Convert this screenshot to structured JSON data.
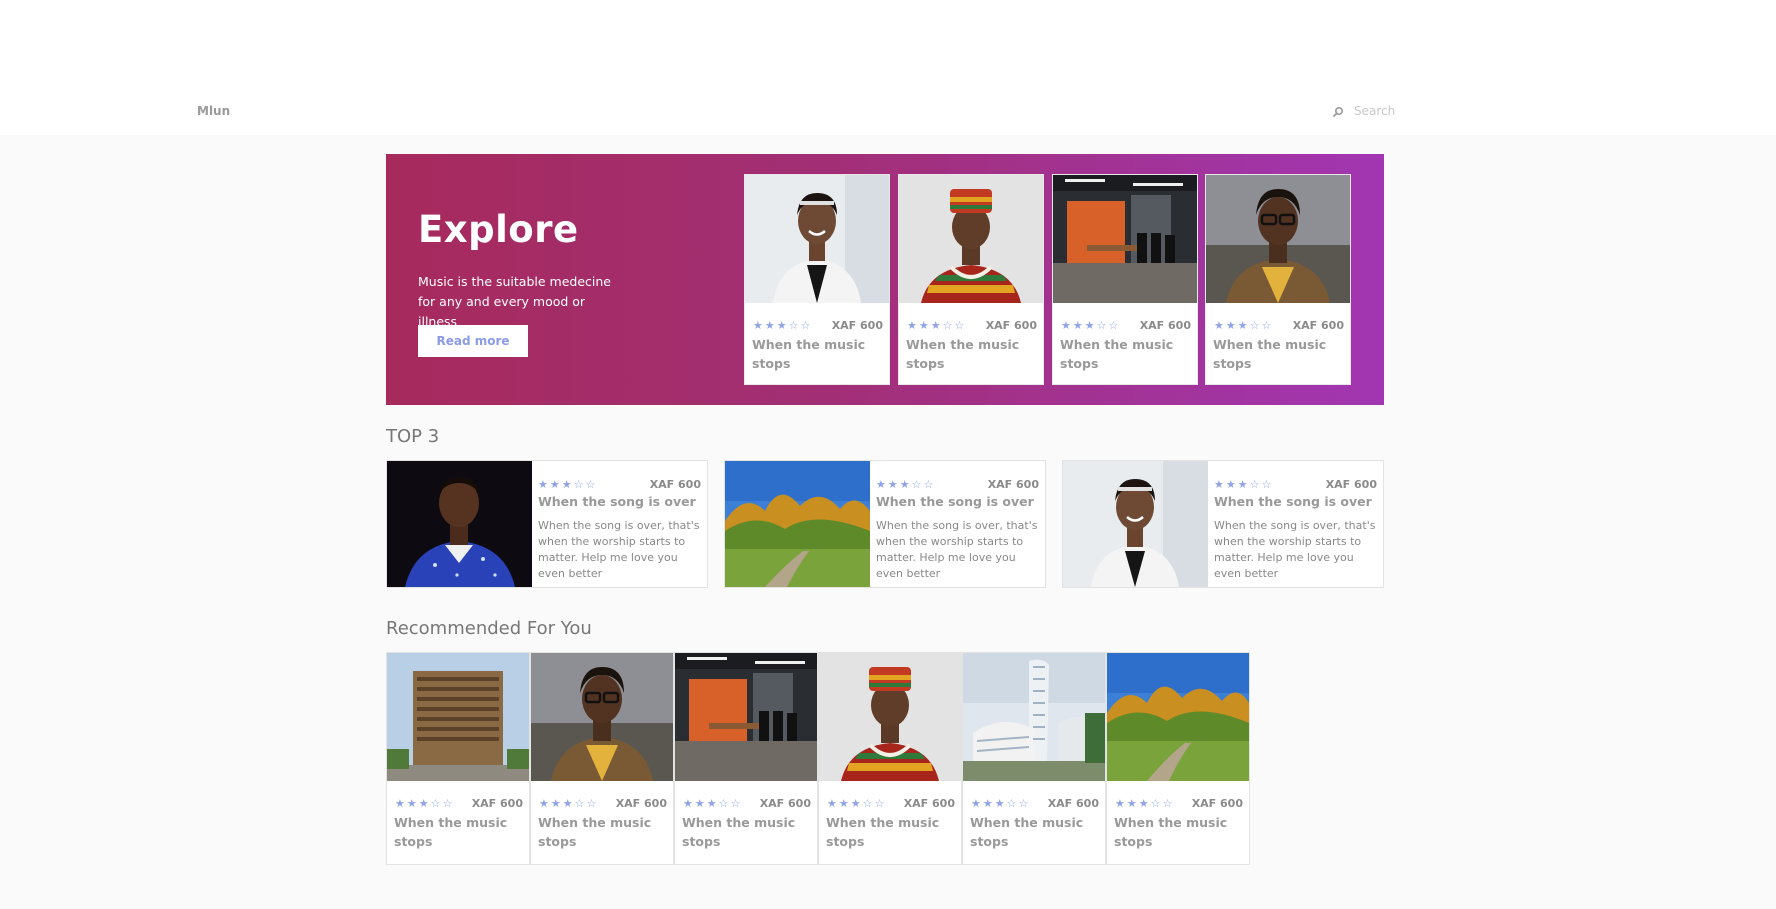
{
  "header": {
    "brand": "Mlun",
    "search_placeholder": "Search"
  },
  "hero": {
    "title": "Explore",
    "text": "Music is the suitable medecine for any and every mood or illness",
    "button_label": "Read more",
    "cards": [
      {
        "image": "woman-white-blazer-photo",
        "rating": 3,
        "price": "XAF 600",
        "title": "When the music stops"
      },
      {
        "image": "man-traditional-attire-photo",
        "rating": 3,
        "price": "XAF 600",
        "title": "When the music stops"
      },
      {
        "image": "office-orange-room-photo",
        "rating": 3,
        "price": "XAF 600",
        "title": "When the music stops"
      },
      {
        "image": "woman-glasses-photo",
        "rating": 3,
        "price": "XAF 600",
        "title": "When the music stops"
      }
    ]
  },
  "top3": {
    "title": "TOP 3",
    "items": [
      {
        "image": "man-blue-shirt-photo",
        "rating": 3,
        "price": "XAF 600",
        "title": "When the song is over",
        "description": "When the song is over, that's when the worship starts to matter. Help me love you even better"
      },
      {
        "image": "forest-path-photo",
        "rating": 3,
        "price": "XAF 600",
        "title": "When the song is over",
        "description": "When the song is over, that's when the worship starts to matter. Help me love you even better"
      },
      {
        "image": "woman-white-blazer-photo",
        "rating": 3,
        "price": "XAF 600",
        "title": "When the song is over",
        "description": "When the song is over, that's when the worship starts to matter. Help me love you even better"
      }
    ]
  },
  "recommended": {
    "title": "Recommended For You",
    "items": [
      {
        "image": "building-tower-photo",
        "rating": 3,
        "price": "XAF 600",
        "title": "When the music stops"
      },
      {
        "image": "woman-glasses-photo",
        "rating": 3,
        "price": "XAF 600",
        "title": "When the music stops"
      },
      {
        "image": "office-orange-room-photo",
        "rating": 3,
        "price": "XAF 600",
        "title": "When the music stops"
      },
      {
        "image": "man-traditional-attire-photo",
        "rating": 3,
        "price": "XAF 600",
        "title": "When the music stops"
      },
      {
        "image": "modern-architecture-photo",
        "rating": 3,
        "price": "XAF 600",
        "title": "When the music stops"
      },
      {
        "image": "forest-path-photo",
        "rating": 3,
        "price": "XAF 600",
        "title": "When the music stops"
      }
    ]
  },
  "colors": {
    "hero_start": "#a62a5c",
    "hero_end": "#a236b2",
    "star": "#8fa3e6",
    "button_text": "#8c9be8"
  },
  "icons": [
    "search-icon",
    "star-icon"
  ]
}
